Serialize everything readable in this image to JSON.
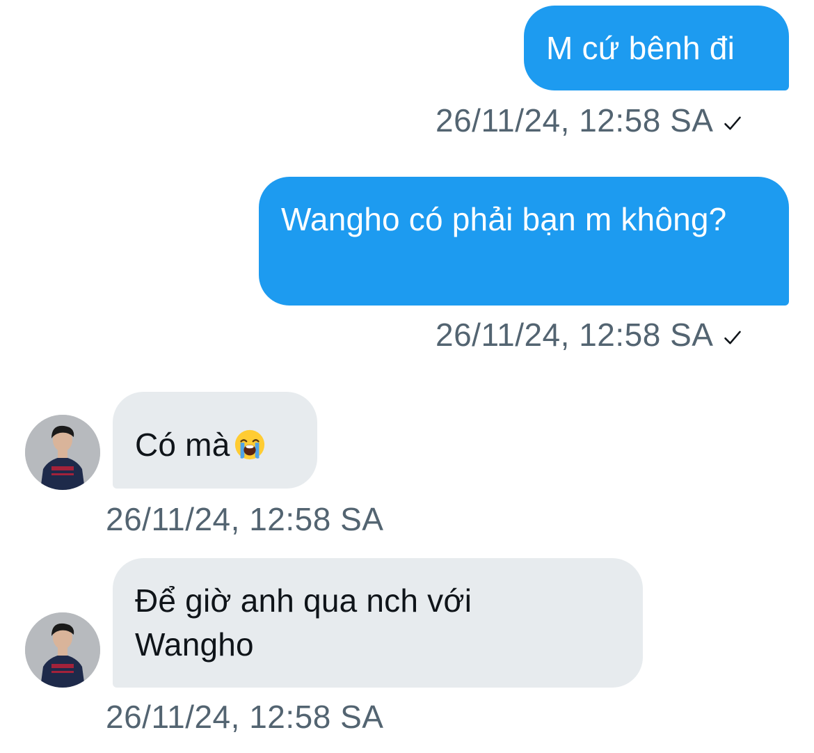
{
  "messages": [
    {
      "direction": "outgoing",
      "text": "M cứ bênh đi",
      "time": "26/11/24, 12:58 SA",
      "status_icon": "check-icon"
    },
    {
      "direction": "outgoing",
      "text": "Wangho có phải bạn m không?",
      "time": "26/11/24, 12:58 SA",
      "status_icon": "check-icon"
    },
    {
      "direction": "incoming",
      "text": "Có mà",
      "emoji": "loudly-crying-face-emoji",
      "time": "26/11/24, 12:58 SA",
      "avatar_icon": "avatar"
    },
    {
      "direction": "incoming",
      "text": "Để giờ anh qua nch với Wangho",
      "time": "26/11/24, 12:58 SA",
      "avatar_icon": "avatar"
    }
  ],
  "colors": {
    "outgoing_bubble": "#1d9bf0",
    "incoming_bubble": "#e7ebee",
    "timestamp": "#536471",
    "text_dark": "#0f1419"
  }
}
